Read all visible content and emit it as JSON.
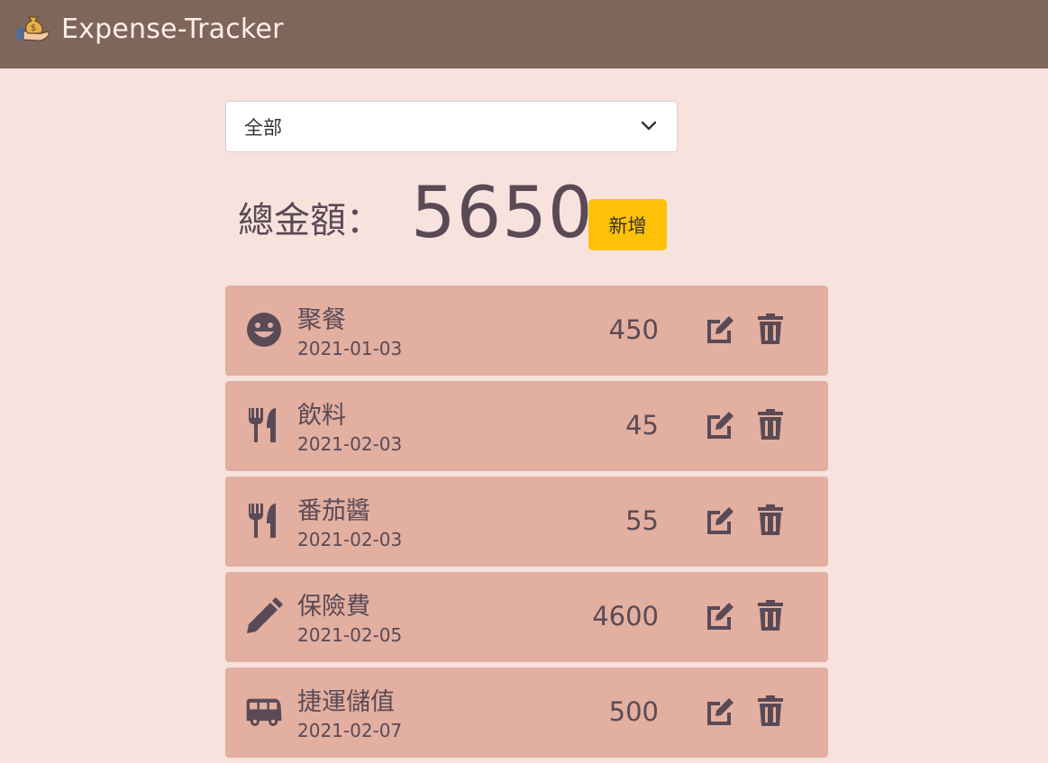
{
  "app": {
    "title": "Expense-Tracker"
  },
  "filter": {
    "selected": "全部"
  },
  "summary": {
    "label": "總金額：",
    "total": "5650"
  },
  "actions": {
    "add_label": "新增"
  },
  "records": [
    {
      "name": "聚餐",
      "date": "2021-01-03",
      "amount": "450",
      "icon": "smile-icon"
    },
    {
      "name": "飲料",
      "date": "2021-02-03",
      "amount": "45",
      "icon": "utensils-icon"
    },
    {
      "name": "番茄醬",
      "date": "2021-02-03",
      "amount": "55",
      "icon": "utensils-icon"
    },
    {
      "name": "保險費",
      "date": "2021-02-05",
      "amount": "4600",
      "icon": "pencil-icon"
    },
    {
      "name": "捷運儲值",
      "date": "2021-02-07",
      "amount": "500",
      "icon": "bus-icon"
    }
  ],
  "colors": {
    "navbar": "#80655a",
    "background": "#f7e2dd",
    "row": "#e2afa0",
    "button": "#ffc107",
    "text": "#5a4a56"
  }
}
